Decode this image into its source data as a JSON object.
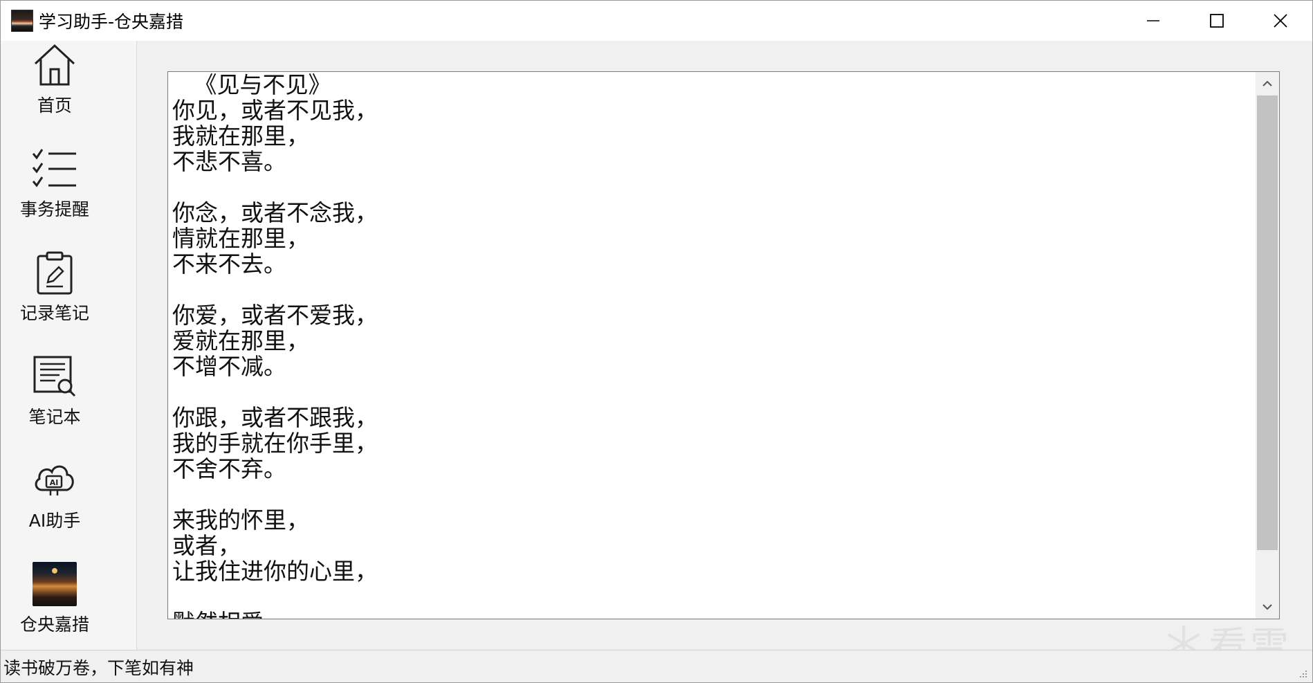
{
  "window": {
    "title": "学习助手-仓央嘉措"
  },
  "sidebar": {
    "items": [
      {
        "label": "首页",
        "icon": "home-icon"
      },
      {
        "label": "事务提醒",
        "icon": "checklist-icon"
      },
      {
        "label": "记录笔记",
        "icon": "clipboard-edit-icon"
      },
      {
        "label": "笔记本",
        "icon": "document-search-icon"
      },
      {
        "label": "AI助手",
        "icon": "ai-cloud-icon"
      },
      {
        "label": "仓央嘉措",
        "icon": "profile-avatar"
      }
    ]
  },
  "editor": {
    "lines": [
      "   《见与不见》",
      "你见，或者不见我，",
      "我就在那里，",
      "不悲不喜。",
      "",
      "你念，或者不念我，",
      "情就在那里，",
      "不来不去。",
      "",
      "你爱，或者不爱我，",
      "爱就在那里，",
      "不增不减。",
      "",
      "你跟，或者不跟我，",
      "我的手就在你手里，",
      "不舍不弃。",
      "",
      "来我的怀里，",
      "或者，",
      "让我住进你的心里，",
      "",
      "默然相爱"
    ]
  },
  "statusbar": {
    "text": "读书破万卷，下笔如有神"
  },
  "watermark": {
    "text": "看雪"
  }
}
